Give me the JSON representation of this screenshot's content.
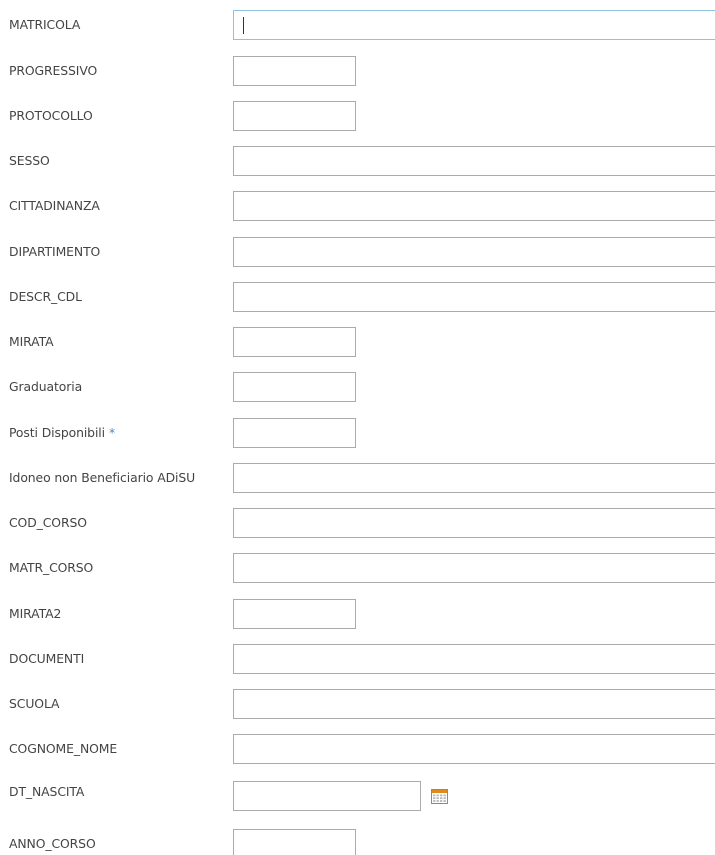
{
  "form": {
    "fields": [
      {
        "label": "MATRICOLA",
        "value": "",
        "focused": true
      },
      {
        "label": "PROGRESSIVO",
        "value": ""
      },
      {
        "label": "PROTOCOLLO",
        "value": ""
      },
      {
        "label": "SESSO",
        "value": ""
      },
      {
        "label": "CITTADINANZA",
        "value": ""
      },
      {
        "label": "DIPARTIMENTO",
        "value": ""
      },
      {
        "label": "DESCR_CDL",
        "value": ""
      },
      {
        "label": "MIRATA",
        "value": ""
      },
      {
        "label": "Graduatoria",
        "value": ""
      },
      {
        "label": "Posti Disponibili",
        "required_marker": "*",
        "required": true,
        "value": ""
      },
      {
        "label": "Idoneo non Beneficiario ADiSU",
        "value": ""
      },
      {
        "label": "COD_CORSO",
        "value": ""
      },
      {
        "label": "MATR_CORSO",
        "value": ""
      },
      {
        "label": "MIRATA2",
        "value": ""
      },
      {
        "label": "DOCUMENTI",
        "value": ""
      },
      {
        "label": "SCUOLA",
        "value": ""
      },
      {
        "label": "COGNOME_NOME",
        "value": ""
      },
      {
        "label": "DT_NASCITA",
        "value": "",
        "icon": "calendar-icon"
      },
      {
        "label": "ANNO_CORSO",
        "value": ""
      }
    ]
  },
  "colors": {
    "label_text": "#444444",
    "field_border": "#ababab",
    "focused_border": "#92c0e0",
    "required_marker": "#4a89c7"
  }
}
